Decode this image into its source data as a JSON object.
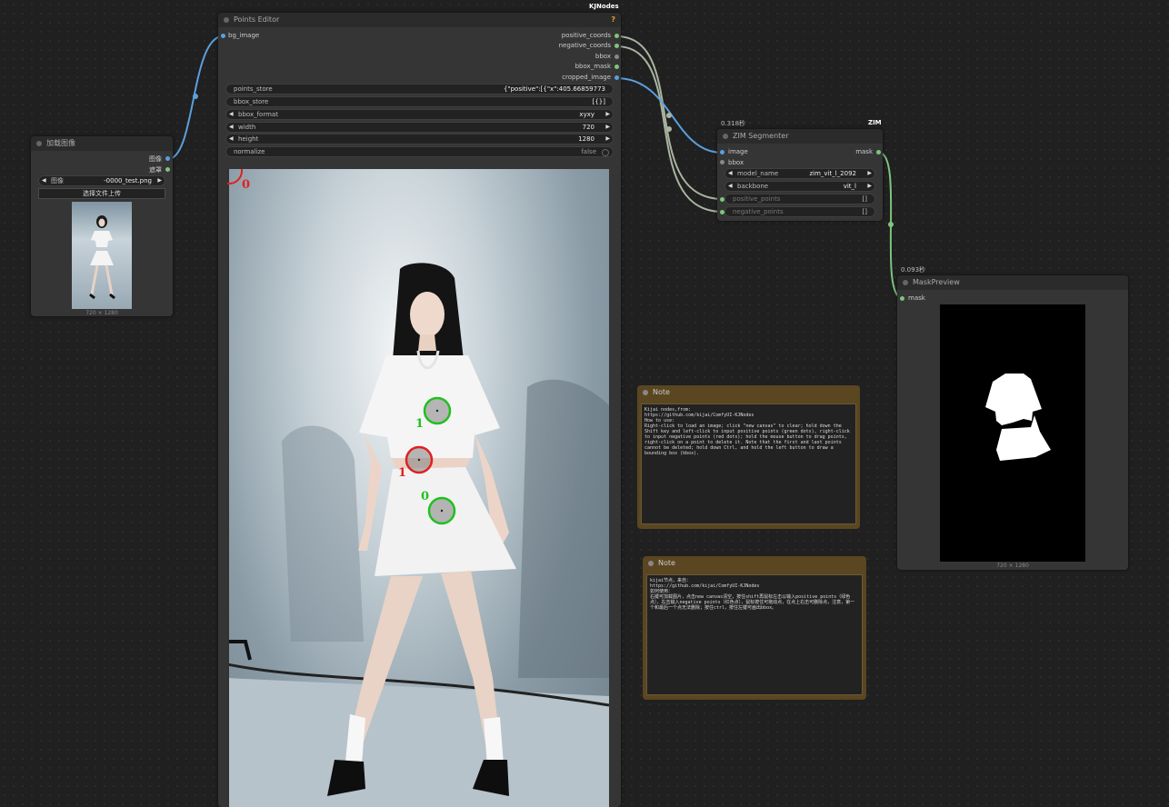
{
  "colors": {
    "canvas_bg": "#202020",
    "node_bg": "#353535",
    "node_header": "#2b2b2b",
    "link_image": "#5aa0dc",
    "link_mask": "#7ec47e",
    "link_coords": "#a8b4a0",
    "point_positive": "#20c020",
    "point_negative": "#e02020",
    "note_bg": "#5a4621"
  },
  "load_image": {
    "title": "加载图像",
    "outputs": {
      "image": "图像",
      "mask": "遮罩"
    },
    "image_label": "图像",
    "image_value": "-0000_test.png",
    "upload_button": "选择文件上传",
    "dims": "720 × 1280"
  },
  "points_editor": {
    "badge": "KJNodes",
    "help": "?",
    "title": "Points Editor",
    "input_bg": "bg_image",
    "outputs": {
      "positive": "positive_coords",
      "negative": "negative_coords",
      "bbox": "bbox",
      "bbox_mask": "bbox_mask",
      "cropped": "cropped_image"
    },
    "widgets": {
      "points_store_label": "points_store",
      "points_store_value": "{\"positive\":[{\"x\":405.66859773",
      "bbox_store_label": "bbox_store",
      "bbox_store_value": "[{}]",
      "bbox_format_label": "bbox_format",
      "bbox_format_value": "xyxy",
      "width_label": "width",
      "width_value": "720",
      "height_label": "height",
      "height_value": "1280",
      "normalize_label": "normalize",
      "normalize_value": "false"
    },
    "point_labels": {
      "p0": "0",
      "g1": "1",
      "r1": "1",
      "g0": "0"
    }
  },
  "zim": {
    "time": "0.318秒",
    "tag": "ZIM",
    "title": "ZIM Segmenter",
    "inputs": {
      "image": "image",
      "bbox": "bbox"
    },
    "output": "mask",
    "model_label": "model_name",
    "model_value": "zim_vit_l_2092",
    "backbone_label": "backbone",
    "backbone_value": "vit_l",
    "pos_label": "positive_points",
    "pos_value": "[]",
    "neg_label": "negative_points",
    "neg_value": "[]"
  },
  "mask_preview": {
    "time": "0.093秒",
    "title": "MaskPreview",
    "input": "mask",
    "dims": "720 × 1280"
  },
  "note_en": {
    "title": "Note",
    "text": "Kijai nodes,from:\nhttps://github.com/kijai/ComfyUI-KJNodes\nHow to use:\nRight-click to load an image; click \"new canvas\" to clear; hold down the Shift key and left-click to input positive points (green dots), right-click to input negative points (red dots); hold the mouse button to drag points, right-click on a point to delete it. Note that the first and last points cannot be deleted; hold down Ctrl, and hold the left button to draw a bounding box (bbox)."
  },
  "note_zh": {
    "title": "Note",
    "text": "kijai节点，来自：\nhttps://github.com/kijai/ComfyUI-KJNodes\n如何使用：\n右键可加载图片，点击new canvas清空，按住shift再鼠标左击以输入positive points（绿色点），右击输入negative points（红色点），鼠标按住可拖动点，在点上右击可删除点，注意，第一个和最后一个点无法删除；按住ctrl，按住左键可画出bbox。"
  }
}
